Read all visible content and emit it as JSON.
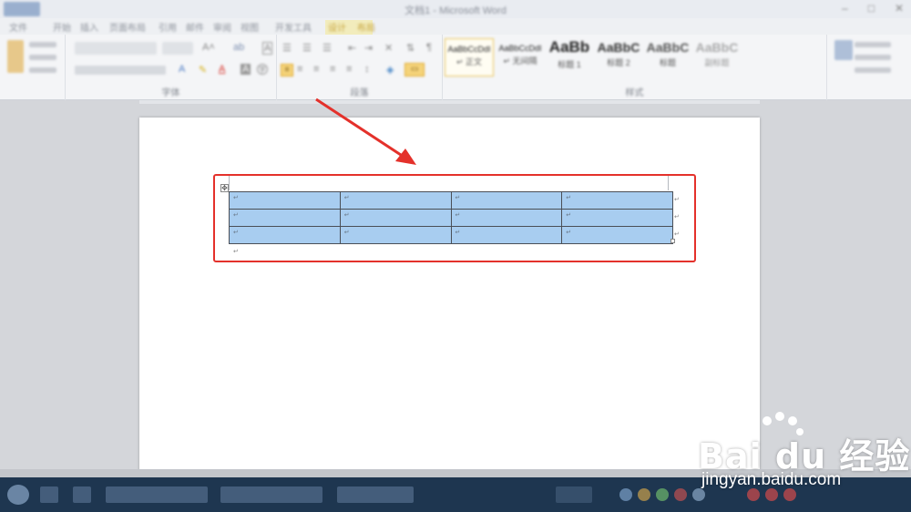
{
  "window": {
    "title": "文档1 - Microsoft Word",
    "controls": [
      "–",
      "□",
      "✕"
    ]
  },
  "tabs": [
    "文件",
    "开始",
    "插入",
    "页面布局",
    "引用",
    "邮件",
    "审阅",
    "视图",
    "开发工具",
    "设计",
    "布局"
  ],
  "ribbon": {
    "groups": {
      "font": "字体",
      "paragraph": "段落",
      "styles": "样式"
    },
    "styles": [
      {
        "sample": "AaBbCcDdI",
        "name": "↵ 正文"
      },
      {
        "sample": "AaBbCcDdI",
        "name": "↵ 无间隔"
      },
      {
        "sample": "AaBb",
        "name": "标题 1"
      },
      {
        "sample": "AaBbC",
        "name": "标题 2"
      },
      {
        "sample": "AaBbC",
        "name": "标题"
      },
      {
        "sample": "AaBbC",
        "name": "副标题"
      }
    ]
  },
  "document": {
    "table": {
      "rows": 3,
      "cols": 4,
      "cell_mark": "↵",
      "fill": "#a8cdf0"
    },
    "paragraph_mark": "↵"
  },
  "annotation": {
    "color": "#e4312b"
  },
  "watermark": {
    "logo": "Bai du 经验",
    "url": "jingyan.baidu.com"
  }
}
